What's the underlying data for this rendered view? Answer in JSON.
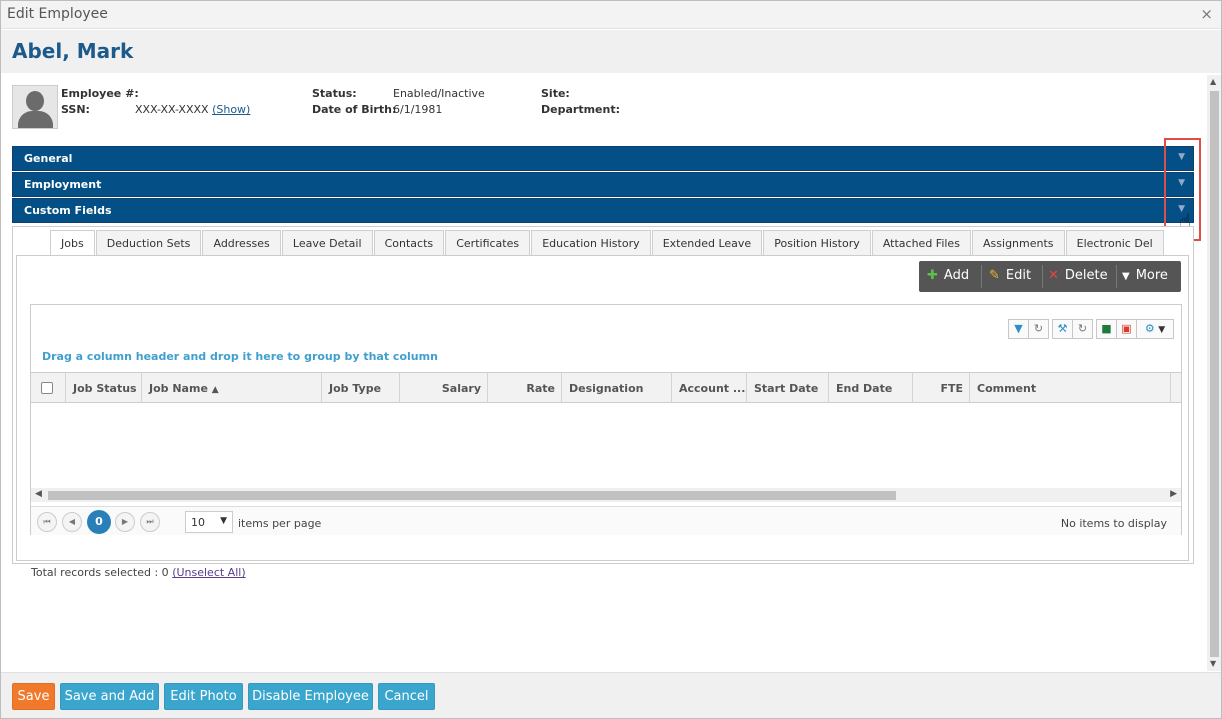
{
  "window": {
    "title": "Edit Employee",
    "close_icon": "×"
  },
  "employee": {
    "name": "Abel, Mark",
    "fields": {
      "employee_no_label": "Employee #:",
      "employee_no": "",
      "ssn_label": "SSN:",
      "ssn": "XXX-XX-XXXX",
      "ssn_show": "(Show)",
      "status_label": "Status:",
      "status": "Enabled/Inactive",
      "dob_label": "Date of Birth:",
      "dob": "6/1/1981",
      "site_label": "Site:",
      "site": "",
      "department_label": "Department:",
      "department": ""
    }
  },
  "panels": [
    {
      "title": "General"
    },
    {
      "title": "Employment"
    },
    {
      "title": "Custom Fields"
    }
  ],
  "tabs": [
    {
      "label": "Jobs",
      "active": true
    },
    {
      "label": "Deduction Sets"
    },
    {
      "label": "Addresses"
    },
    {
      "label": "Leave Detail"
    },
    {
      "label": "Contacts"
    },
    {
      "label": "Certificates"
    },
    {
      "label": "Education History"
    },
    {
      "label": "Extended Leave"
    },
    {
      "label": "Position History"
    },
    {
      "label": "Attached Files"
    },
    {
      "label": "Assignments"
    },
    {
      "label": "Electronic Del"
    }
  ],
  "toolbar": {
    "add": "Add",
    "edit": "Edit",
    "delete": "Delete",
    "more": "More"
  },
  "grid": {
    "group_hint": "Drag a column header and drop it here to group by that column",
    "columns": [
      "Job Status",
      "Job Name",
      "Job Type",
      "Salary",
      "Rate",
      "Designation",
      "Account ...",
      "Start Date",
      "End Date",
      "FTE",
      "Comment"
    ],
    "sort_indicator": "▲",
    "rows": [],
    "pager": {
      "current_page": "0",
      "page_size": "10",
      "items_per_page": "items per page",
      "no_items": "No items to display"
    },
    "selection": {
      "text": "Total records selected : 0",
      "unselect": "(Unselect All)"
    }
  },
  "footer": {
    "save": "Save",
    "save_and_add": "Save and Add",
    "edit_photo": "Edit Photo",
    "disable_employee": "Disable Employee",
    "cancel": "Cancel"
  },
  "colors": {
    "panel_bar": "#044f85",
    "title": "#1d5a8c",
    "save_button": "#f0792b",
    "footer_button": "#3aa6ce",
    "highlight_box": "#e04b4b",
    "group_hint": "#3f9fcf",
    "pager_current": "#2980b9"
  }
}
